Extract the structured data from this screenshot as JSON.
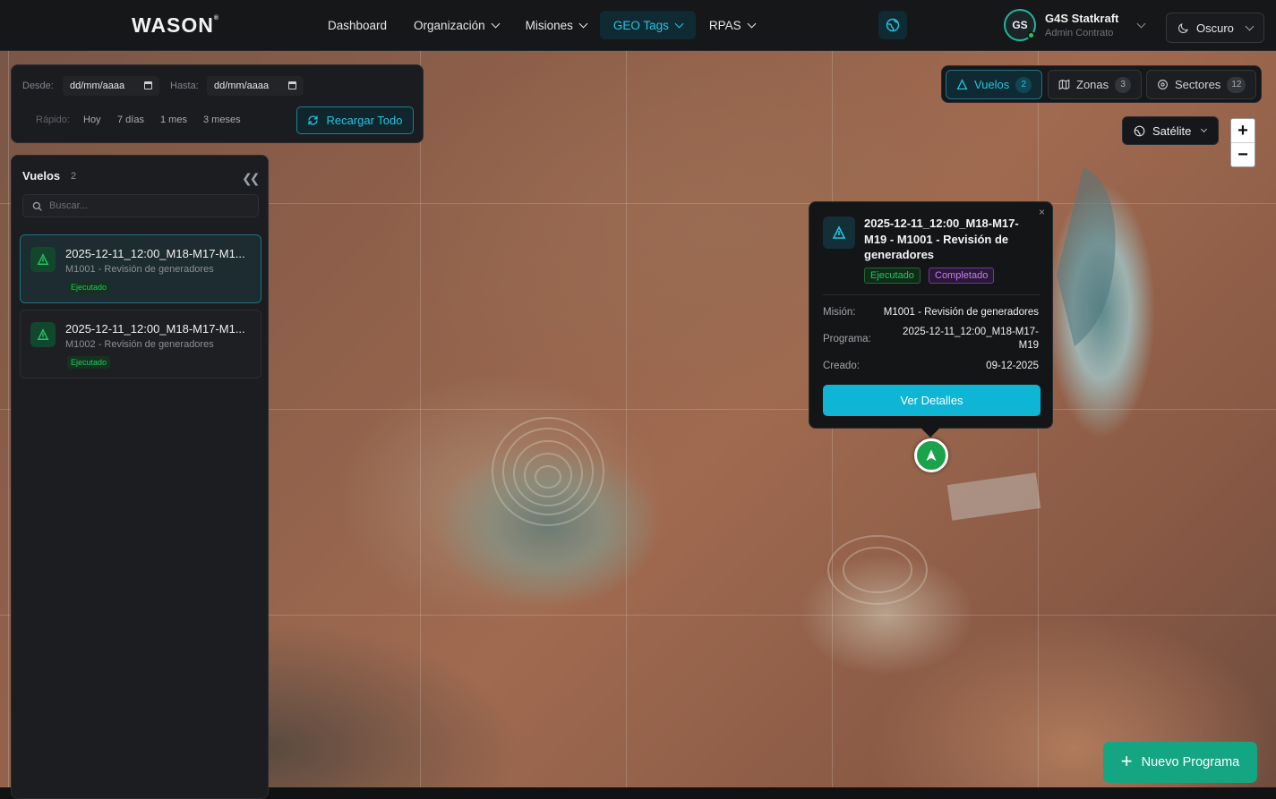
{
  "header": {
    "logo": "WASON",
    "logo_mark": "®",
    "nav": [
      {
        "label": "Dashboard",
        "dropdown": false,
        "active": false
      },
      {
        "label": "Organización",
        "dropdown": true,
        "active": false
      },
      {
        "label": "Misiones",
        "dropdown": true,
        "active": false
      },
      {
        "label": "GEO Tags",
        "dropdown": true,
        "active": true
      },
      {
        "label": "RPAS",
        "dropdown": true,
        "active": false
      }
    ],
    "user": {
      "initials": "GS",
      "name": "G4S Statkraft",
      "role": "Admin Contrato",
      "status": "online"
    },
    "theme": "Oscuro"
  },
  "filters": {
    "from_label": "Desde:",
    "from_value": "dd/mm/aaaa",
    "to_label": "Hasta:",
    "to_value": "dd/mm/aaaa",
    "quick_label": "Rápido:",
    "quick": [
      "Hoy",
      "7 días",
      "1 mes",
      "3 meses"
    ],
    "reload": "Recargar Todo"
  },
  "list": {
    "title": "Vuelos",
    "count": "2",
    "search_placeholder": "Buscar...",
    "items": [
      {
        "title": "2025-12-11_12:00_M18-M17-M1...",
        "subtitle": "M1001 - Revisión de generadores",
        "status": "Ejecutado",
        "selected": true
      },
      {
        "title": "2025-12-11_12:00_M18-M17-M1...",
        "subtitle": "M1002 - Revisión de generadores",
        "status": "Ejecutado",
        "selected": false
      }
    ]
  },
  "layers": {
    "tabs": [
      {
        "label": "Vuelos",
        "count": "2",
        "active": true,
        "icon": "plane-icon"
      },
      {
        "label": "Zonas",
        "count": "3",
        "active": false,
        "icon": "map-icon"
      },
      {
        "label": "Sectores",
        "count": "12",
        "active": false,
        "icon": "pin-icon"
      }
    ],
    "basemap": "Satélite",
    "zoom_in": "+",
    "zoom_out": "−"
  },
  "popup": {
    "title": "2025-12-11_12:00_M18-M17-M19 - M1001 - Revisión de generadores",
    "badges": [
      "Ejecutado",
      "Completado"
    ],
    "mission_label": "Misión:",
    "mission_value": "M1001 - Revisión de generadores",
    "program_label": "Programa:",
    "program_value_1": "2025-12-11_12:00_M18-M17-",
    "program_value_2": "M19",
    "created_label": "Creado:",
    "created_value": "09-12-2025",
    "button": "Ver Detalles",
    "close": "×"
  },
  "actions": {
    "new_program": "Nuevo Programa"
  },
  "colors": {
    "accent": "#23c4e0",
    "success": "#22c55e",
    "completed": "#c67ef0",
    "primary_button": "#14a582"
  }
}
